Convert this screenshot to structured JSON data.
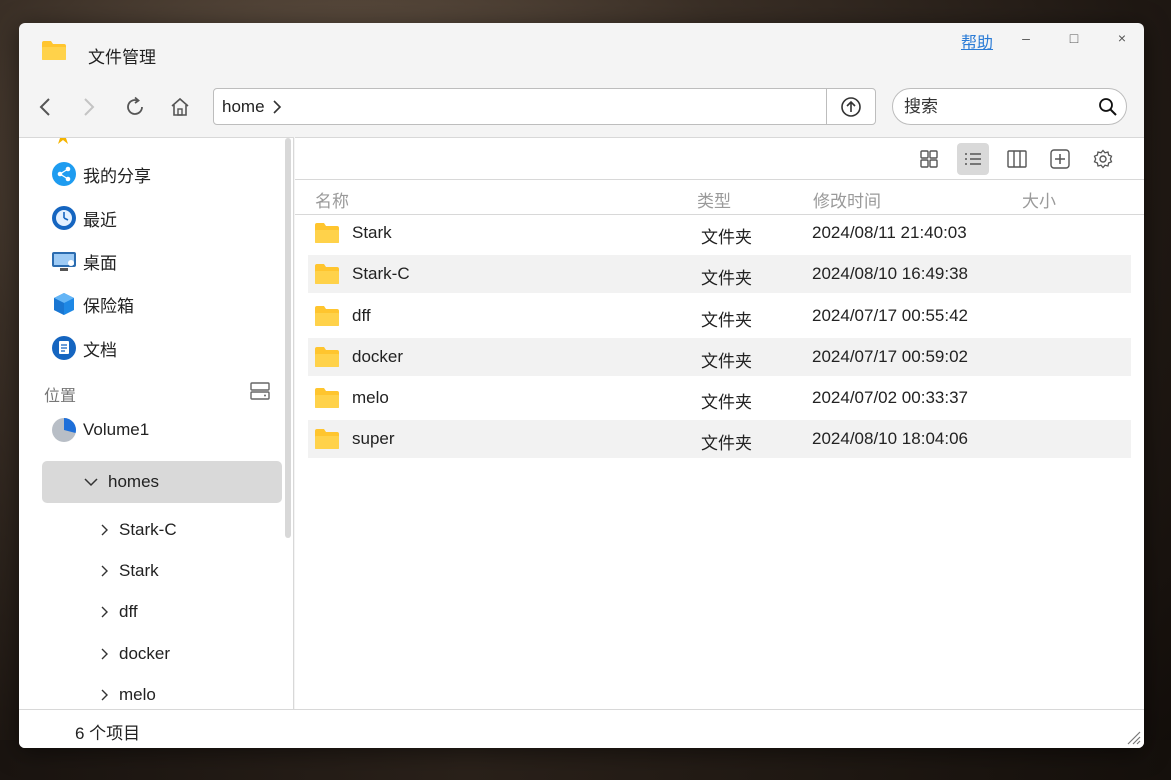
{
  "app": {
    "title": "文件管理",
    "help_label": "帮助",
    "minimize_label": "–",
    "maximize_label": "□",
    "close_label": "×"
  },
  "nav": {
    "path": "home",
    "search_placeholder": "搜索"
  },
  "sidebar": {
    "items": [
      {
        "label": "我的分享",
        "icon": "share-icon"
      },
      {
        "label": "最近",
        "icon": "clock-icon"
      },
      {
        "label": "桌面",
        "icon": "desktop-icon"
      },
      {
        "label": "保险箱",
        "icon": "vault-icon"
      },
      {
        "label": "文档",
        "icon": "document-icon"
      }
    ],
    "location_section": "位置",
    "volume": "Volume1",
    "homes": "homes",
    "sub_items": [
      "Stark-C",
      "Stark",
      "dff",
      "docker",
      "melo"
    ]
  },
  "columns": {
    "name": "名称",
    "type": "类型",
    "modified": "修改时间",
    "size": "大小"
  },
  "files": [
    {
      "name": "Stark",
      "type": "文件夹",
      "modified": "2024/08/11 21:40:03"
    },
    {
      "name": "Stark-C",
      "type": "文件夹",
      "modified": "2024/08/10 16:49:38"
    },
    {
      "name": "dff",
      "type": "文件夹",
      "modified": "2024/07/17 00:55:42"
    },
    {
      "name": "docker",
      "type": "文件夹",
      "modified": "2024/07/17 00:59:02"
    },
    {
      "name": "melo",
      "type": "文件夹",
      "modified": "2024/07/02 00:33:37"
    },
    {
      "name": "super",
      "type": "文件夹",
      "modified": "2024/08/10 18:04:06"
    }
  ],
  "status": {
    "count_text": "6 个项目"
  },
  "colors": {
    "folder": "#ffc52e",
    "link": "#2a7bd6",
    "selected_bg": "#d9d9d9"
  }
}
